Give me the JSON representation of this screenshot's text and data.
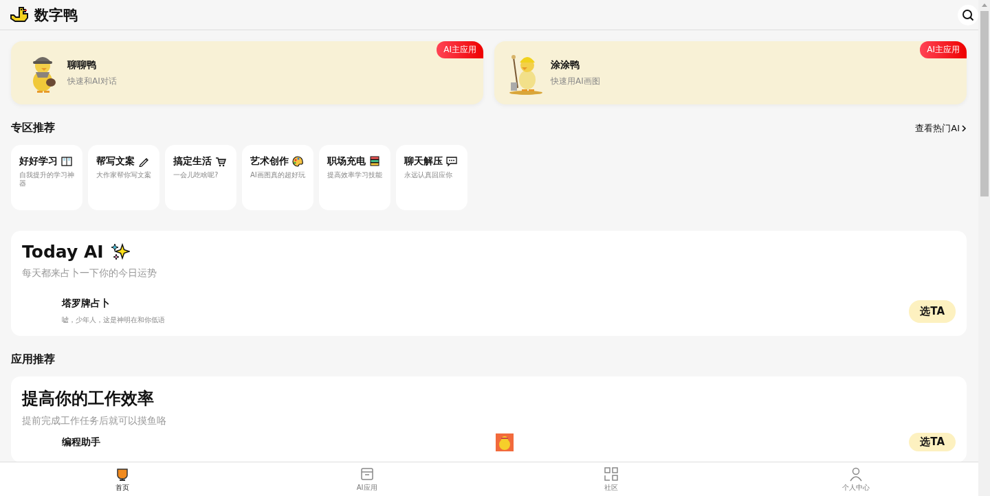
{
  "header": {
    "brand": "数字鸭"
  },
  "main_apps": [
    {
      "name": "聊聊鸭",
      "desc": "快速和AI对话",
      "badge": "AI主应用"
    },
    {
      "name": "涂涂鸭",
      "desc": "快速用AI画图",
      "badge": "AI主应用"
    }
  ],
  "zones": {
    "title": "专区推荐",
    "more_link": "查看热门AI",
    "items": [
      {
        "title": "好好学习",
        "desc": "自我提升的学习神器"
      },
      {
        "title": "帮写文案",
        "desc": "大作家帮你写文案"
      },
      {
        "title": "搞定生活",
        "desc": "一会儿吃啥呢?"
      },
      {
        "title": "艺术创作",
        "desc": "AI画图真的超好玩"
      },
      {
        "title": "职场充电",
        "desc": "提高效率学习技能"
      },
      {
        "title": "聊天解压",
        "desc": "永远认真回应你"
      }
    ]
  },
  "today": {
    "title": "Today AI",
    "subtitle": "每天都来占卜一下你的今日运势",
    "apps": [
      {
        "name": "塔罗牌占卜",
        "desc": "嘘，少年人，这是神明在和你低语",
        "button": "选TA"
      }
    ]
  },
  "recommend": {
    "title": "应用推荐",
    "card_title": "提高你的工作效率",
    "card_subtitle": "提前完成工作任务后就可以摸鱼咯",
    "apps": [
      {
        "name": "编程助手",
        "button": "选TA"
      }
    ]
  },
  "tabbar": [
    {
      "label": "首页",
      "selected": true
    },
    {
      "label": "AI应用",
      "selected": false
    },
    {
      "label": "社区",
      "selected": false
    },
    {
      "label": "个人中心",
      "selected": false
    }
  ]
}
